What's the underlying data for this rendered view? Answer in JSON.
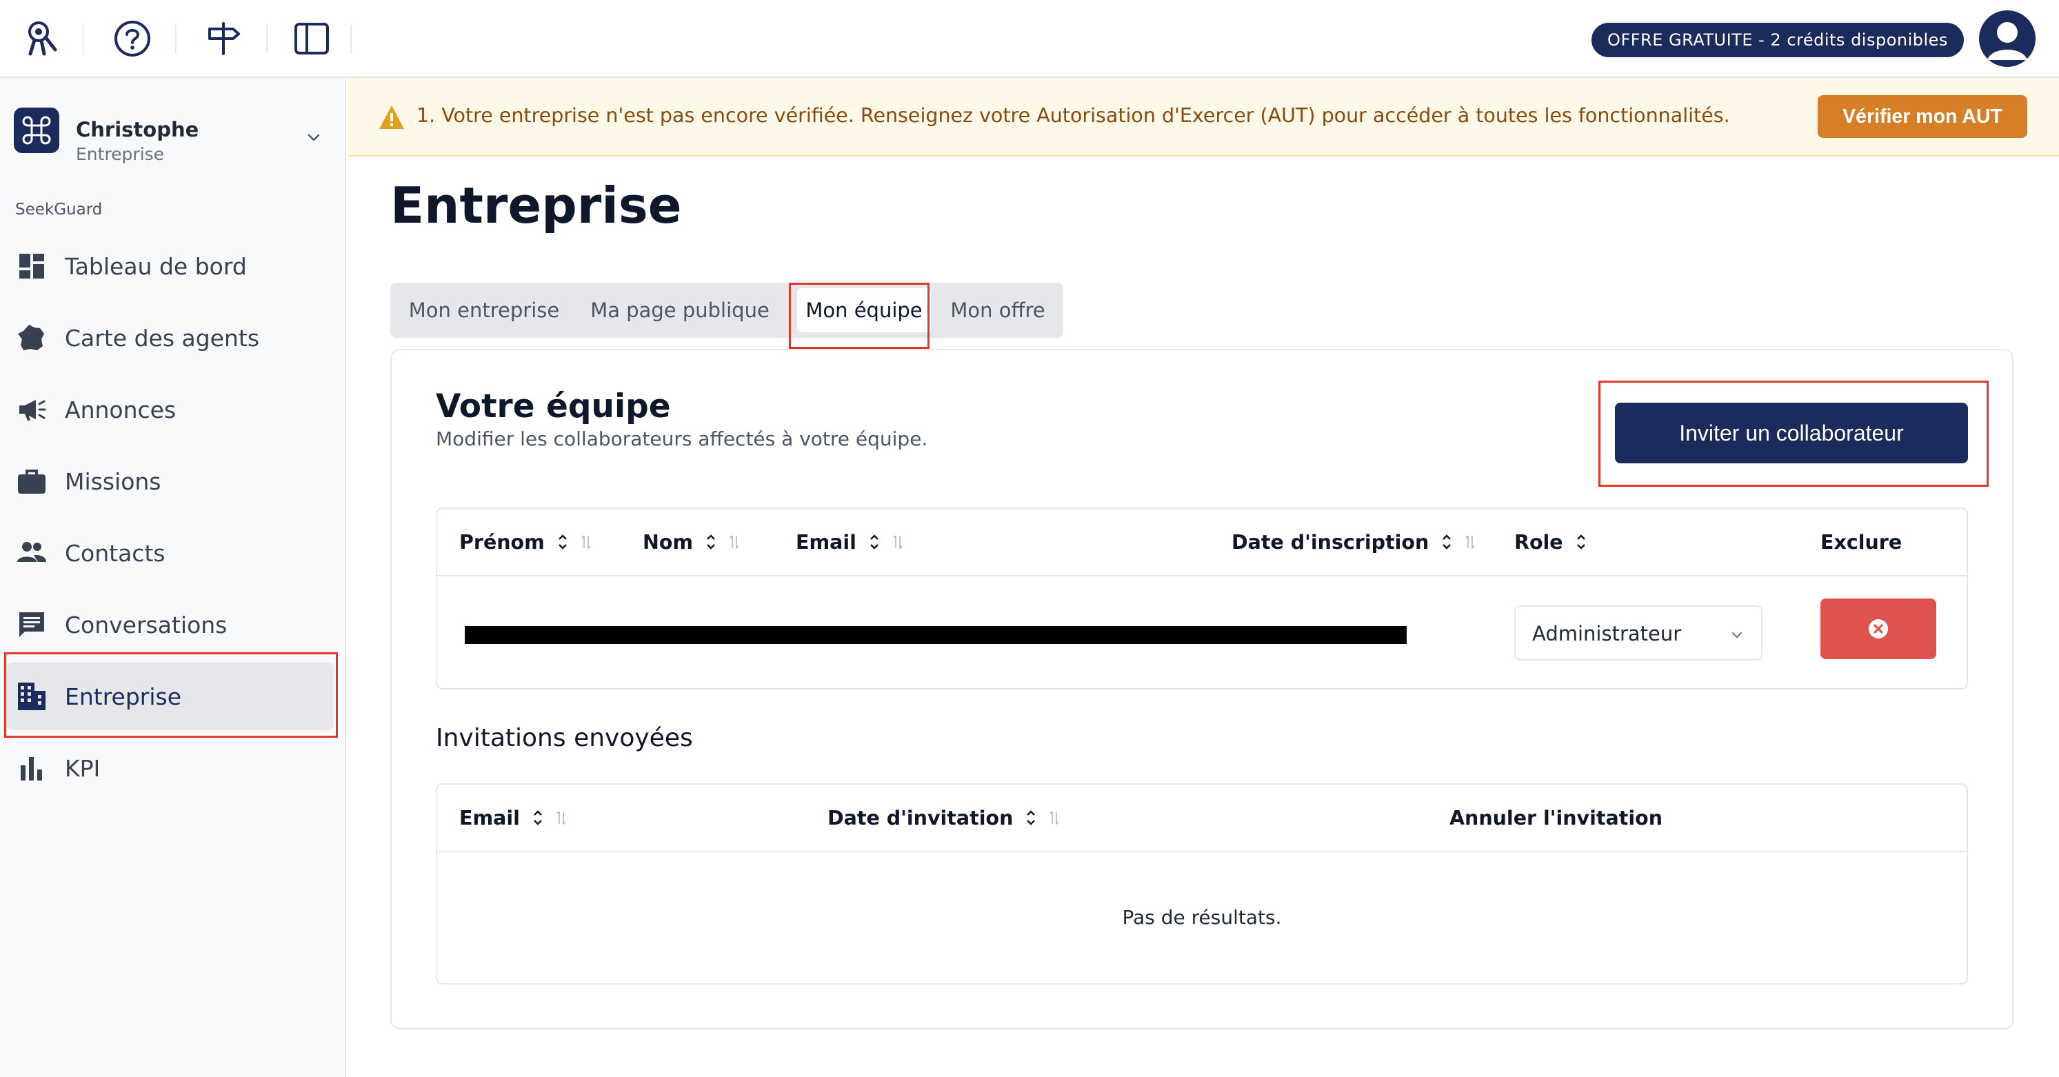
{
  "topbar": {
    "icons": [
      "brand-logo-icon",
      "help-icon",
      "signpost-icon",
      "sidebar-toggle-icon"
    ],
    "credits_badge": "OFFRE GRATUITE - 2 crédits disponibles",
    "avatar_icon": "user-avatar-icon"
  },
  "sidebar": {
    "account_name": "Christophe",
    "account_role": "Entreprise",
    "section_label": "SeekGuard",
    "items": [
      {
        "label": "Tableau de bord",
        "icon": "dashboard-icon"
      },
      {
        "label": "Carte des agents",
        "icon": "france-map-icon"
      },
      {
        "label": "Annonces",
        "icon": "megaphone-icon"
      },
      {
        "label": "Missions",
        "icon": "briefcase-icon"
      },
      {
        "label": "Contacts",
        "icon": "people-icon"
      },
      {
        "label": "Conversations",
        "icon": "chat-icon"
      },
      {
        "label": "Entreprise",
        "icon": "building-icon",
        "active": true
      },
      {
        "label": "KPI",
        "icon": "bar-chart-icon"
      }
    ]
  },
  "banner": {
    "text": "1. Votre entreprise n'est pas encore vérifiée. Renseignez votre Autorisation d'Exercer (AUT) pour accéder à toutes les fonctionnalités.",
    "button": "Vérifier mon AUT"
  },
  "main": {
    "title": "Entreprise",
    "tabs": [
      {
        "label": "Mon entreprise"
      },
      {
        "label": "Ma page publique"
      },
      {
        "label": "Mon équipe",
        "active": true
      },
      {
        "label": "Mon offre"
      }
    ],
    "team": {
      "title": "Votre équipe",
      "subtitle": "Modifier les collaborateurs affectés à votre équipe.",
      "invite_button": "Inviter un collaborateur",
      "columns": [
        "Prénom",
        "Nom",
        "Email",
        "Date d'inscription",
        "Role",
        "Exclure"
      ],
      "rows": [
        {
          "role": "Administrateur"
        }
      ]
    },
    "invitations": {
      "title": "Invitations envoyées",
      "columns": [
        "Email",
        "Date d'invitation",
        "Annuler l'invitation"
      ],
      "empty": "Pas de résultats."
    }
  },
  "colors": {
    "primary": "#1a2b5c",
    "warning_bg": "#fdf8e7",
    "warning_text": "#8a4a0b",
    "warning_button": "#d67f27",
    "danger": "#e0524d",
    "highlight_outline": "#e0392b"
  }
}
